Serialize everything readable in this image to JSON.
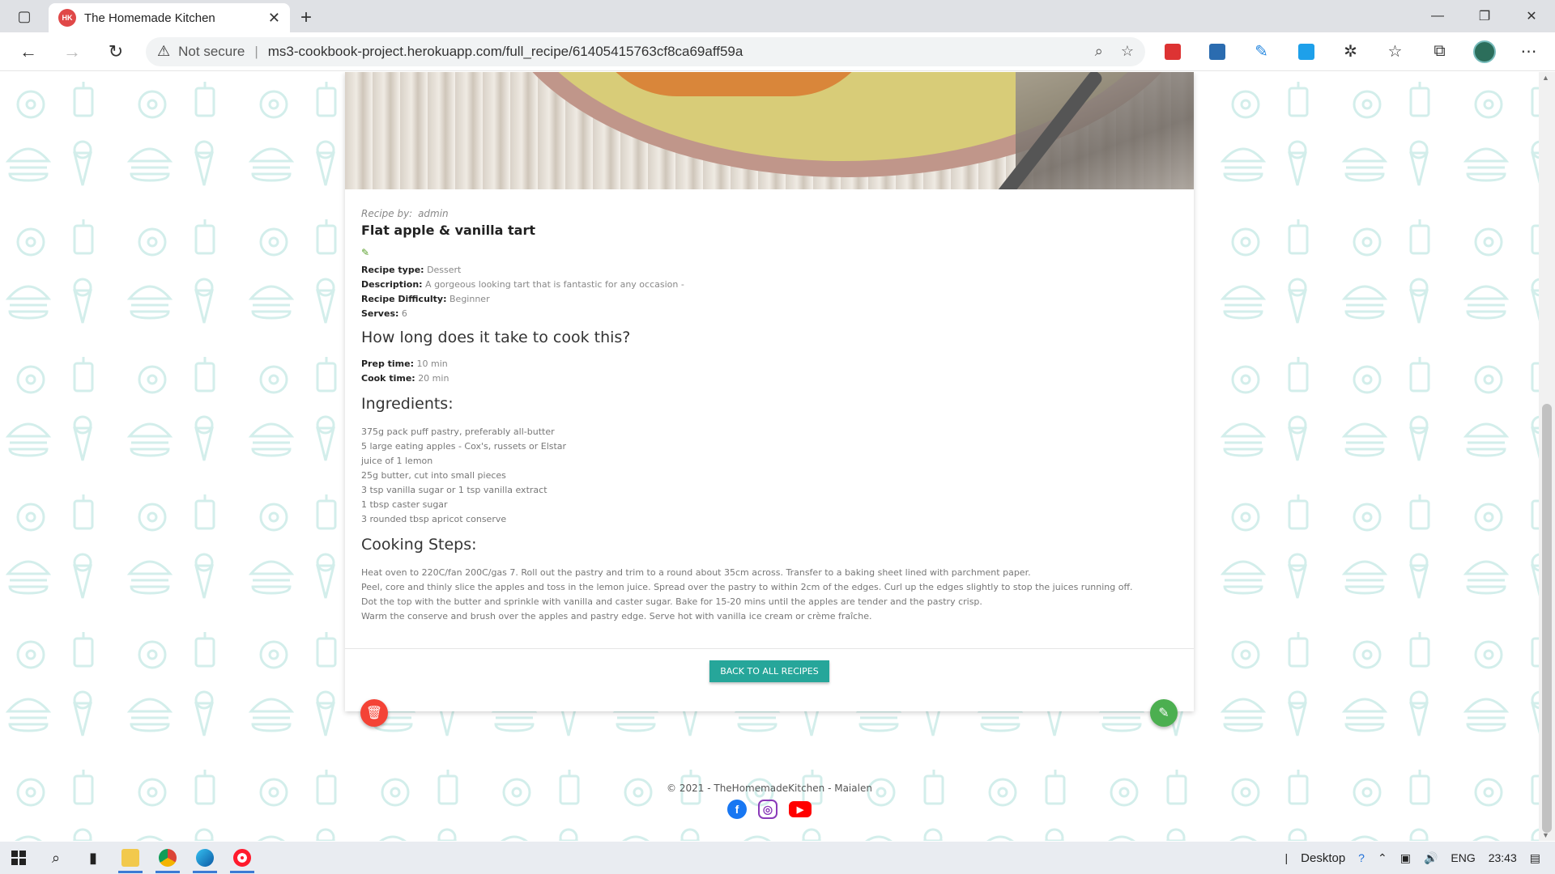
{
  "browser": {
    "tab_title": "The Homemade Kitchen",
    "favicon_text": "HK",
    "security_label": "Not secure",
    "url": "ms3-cookbook-project.herokuapp.com/full_recipe/61405415763cf8ca69aff59a",
    "accent_color": "#3a7bd5"
  },
  "recipe": {
    "byline_label": "Recipe by:",
    "author": "admin",
    "title": "Flat apple & vanilla tart",
    "type_label": "Recipe type:",
    "type": "Dessert",
    "description_label": "Description:",
    "description": "A gorgeous looking tart that is fantastic for any occasion -",
    "difficulty_label": "Recipe Difficulty:",
    "difficulty": "Beginner",
    "serves_label": "Serves:",
    "serves": "6",
    "time_heading": "How long does it take to cook this?",
    "prep_label": "Prep time:",
    "prep_time": "10 min",
    "cook_label": "Cook time:",
    "cook_time": "20 min",
    "ingredients_heading": "Ingredients:",
    "ingredients": [
      "375g pack puff pastry, preferably all-butter",
      "5 large eating apples - Cox's, russets or Elstar",
      "juice of 1 lemon",
      "25g butter, cut into small pieces",
      "3 tsp vanilla sugar or 1 tsp vanilla extract",
      "1 tbsp caster sugar",
      "3 rounded tbsp apricot conserve"
    ],
    "steps_heading": "Cooking Steps:",
    "steps": [
      "Heat oven to 220C/fan 200C/gas 7. Roll out the pastry and trim to a round about 35cm across. Transfer to a baking sheet lined with parchment paper.",
      "Peel, core and thinly slice the apples and toss in the lemon juice. Spread over the pastry to within 2cm of the edges. Curl up the edges slightly to stop the juices running off.",
      "Dot the top with the butter and sprinkle with vanilla and caster sugar. Bake for 15-20 mins until the apples are tender and the pastry crisp.",
      "Warm the conserve and brush over the apples and pastry edge. Serve hot with vanilla ice cream or crème fraîche."
    ],
    "back_button": "BACK TO ALL RECIPES"
  },
  "colors": {
    "primary_button": "#26a69a",
    "delete_button": "#f44336",
    "edit_button": "#4caf50",
    "pattern": "#d3eeeb"
  },
  "footer": {
    "copyright": "© 2021 - TheHomemadeKitchen - Maialen"
  },
  "taskbar": {
    "desktop_label": "Desktop",
    "language": "ENG",
    "time": "23:43"
  }
}
